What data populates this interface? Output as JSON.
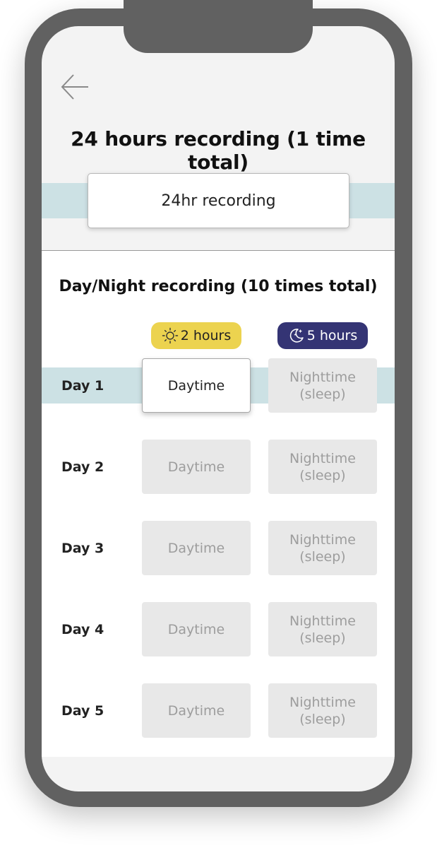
{
  "header": {
    "back_icon": "arrow-left-icon",
    "title": "24 hours recording (1 time total)"
  },
  "full_day": {
    "button_label": "24hr recording",
    "band_color": "#cce1e4"
  },
  "day_night": {
    "title": "Day/Night recording (10 times total)",
    "day_badge": {
      "icon": "sun-icon",
      "label": "2 hours",
      "color": "#ecd34f"
    },
    "night_badge": {
      "icon": "moon-stars-icon",
      "label": "5 hours",
      "color": "#343474"
    },
    "rows": [
      {
        "day": "Day 1",
        "daytime": "Daytime",
        "nighttime": "Nighttime\n(sleep)",
        "selected": "daytime"
      },
      {
        "day": "Day 2",
        "daytime": "Daytime",
        "nighttime": "Nighttime\n(sleep)",
        "selected": ""
      },
      {
        "day": "Day 3",
        "daytime": "Daytime",
        "nighttime": "Nighttime\n(sleep)",
        "selected": ""
      },
      {
        "day": "Day 4",
        "daytime": "Daytime",
        "nighttime": "Nighttime\n(sleep)",
        "selected": ""
      },
      {
        "day": "Day 5",
        "daytime": "Daytime",
        "nighttime": "Nighttime\n(sleep)",
        "selected": ""
      }
    ]
  }
}
